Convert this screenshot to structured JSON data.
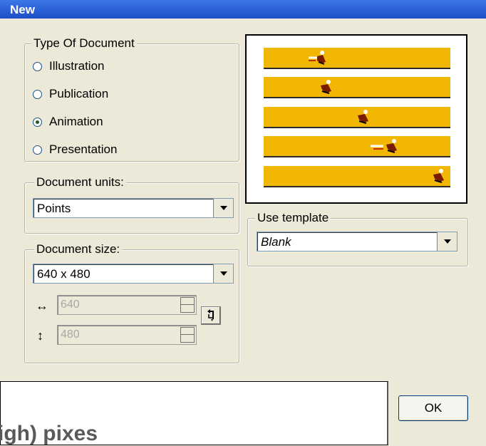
{
  "window": {
    "title": "New"
  },
  "type_group": {
    "legend": "Type Of Document",
    "options": [
      {
        "label": "Illustration",
        "checked": false
      },
      {
        "label": "Publication",
        "checked": false
      },
      {
        "label": "Animation",
        "checked": true
      },
      {
        "label": "Presentation",
        "checked": false
      }
    ]
  },
  "units_group": {
    "legend": "Document units:",
    "selected": "Points"
  },
  "size_group": {
    "legend": "Document size:",
    "selected": "640 x 480",
    "width_value": "640",
    "height_value": "480",
    "width_icon": "horizontal-arrows-icon",
    "height_icon": "vertical-arrows-icon",
    "swap_icon": "swap-orientation-icon"
  },
  "template_group": {
    "legend": "Use template",
    "selected": "Blank"
  },
  "preview": {
    "strip_color": "#f2b705",
    "runner_positions": [
      0.1,
      0.3,
      0.5,
      0.7,
      0.93
    ]
  },
  "tooltip": {
    "text": "igh) pixes"
  },
  "buttons": {
    "ok": "OK"
  },
  "colors": {
    "titlebar": "#2a5fd8",
    "dialog": "#ece9d8"
  }
}
